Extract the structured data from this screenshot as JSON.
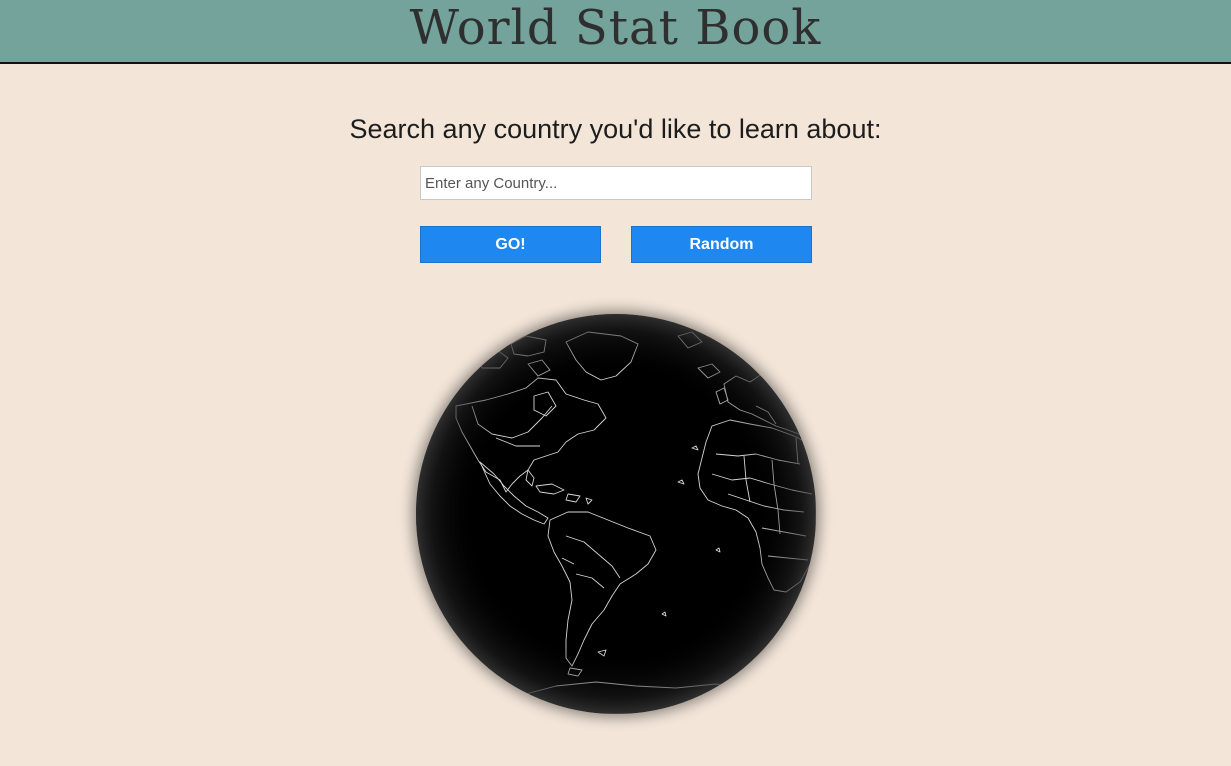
{
  "header": {
    "title": "World Stat Book",
    "background_color": "#73a39b"
  },
  "search": {
    "prompt": "Search any country you'd like to learn about:",
    "placeholder": "Enter any Country...",
    "value": ""
  },
  "buttons": {
    "go_label": "GO!",
    "random_label": "Random",
    "color": "#1e88f0"
  },
  "globe": {
    "icon": "world-globe-map",
    "ocean_color": "#000000",
    "border_color": "#d8d8d8"
  }
}
